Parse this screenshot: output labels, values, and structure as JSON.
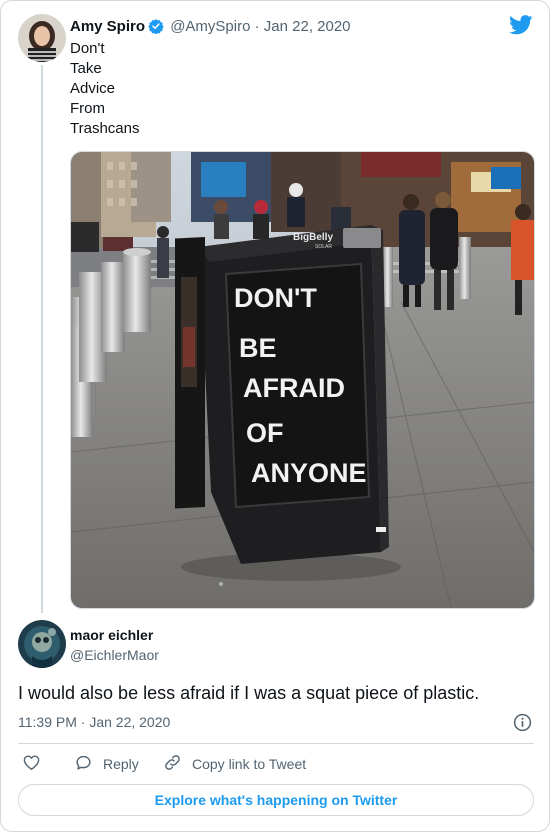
{
  "original_tweet": {
    "name": "Amy Spiro",
    "handle": "@AmySpiro",
    "separator": "·",
    "date": "Jan 22, 2020",
    "text_lines": [
      "Don't",
      "Take",
      "Advice",
      "From",
      "Trashcans"
    ],
    "image": {
      "brand_logo_line1": "BigBelly",
      "brand_logo_line2": "SOLAR",
      "sign_lines": [
        "DON'T",
        "BE",
        "AFRAID",
        "OF",
        "ANYONE"
      ]
    }
  },
  "reply_tweet": {
    "name": "maor eichler",
    "handle": "@EichlerMaor",
    "text": "I would also be less afraid if I was a squat piece of plastic.",
    "time": "11:39 PM · Jan 22, 2020"
  },
  "actions": {
    "reply_label": "Reply",
    "copy_link_label": "Copy link to Tweet"
  },
  "explore_label": "Explore what's happening on Twitter",
  "colors": {
    "accent": "#1d9bf0",
    "secondary_text": "#536471",
    "border": "#cfd9de"
  },
  "icons": [
    "twitter-bird-icon",
    "verified-badge-icon",
    "heart-icon",
    "reply-icon",
    "link-icon",
    "info-icon"
  ]
}
